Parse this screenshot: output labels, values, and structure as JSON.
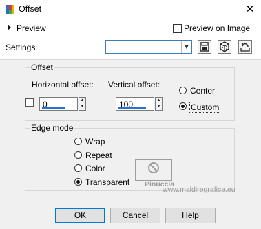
{
  "window": {
    "title": "Offset",
    "close_glyph": "✕",
    "icon": "palette-icon"
  },
  "top": {
    "preview_label": "Preview",
    "preview_on_image_label": "Preview on Image",
    "preview_on_image_checked": false,
    "settings_label": "Settings",
    "settings_value": "",
    "icons": [
      "save-preset-icon",
      "randomize-icon",
      "reset-icon"
    ]
  },
  "offset_group": {
    "title": "Offset",
    "horizontal_label": "Horizontal offset:",
    "horizontal_value": "0",
    "vertical_label": "Vertical offset:",
    "vertical_value": "100",
    "link_checked": false,
    "radio_center": "Center",
    "radio_custom": "Custom",
    "selected": "Custom"
  },
  "edge_group": {
    "title": "Edge mode",
    "options": [
      "Wrap",
      "Repeat",
      "Color",
      "Transparent"
    ],
    "selected": "Transparent"
  },
  "watermark": {
    "line1": "Pinuccia",
    "line2": "www.maldiregrafica.eu"
  },
  "buttons": {
    "ok": "OK",
    "cancel": "Cancel",
    "help": "Help"
  },
  "colors": {
    "panel_bg": "#f0f0f0",
    "accent": "#0078d7",
    "field_underline": "#2a6fd0",
    "no_color_red": "#9d9d9d"
  }
}
